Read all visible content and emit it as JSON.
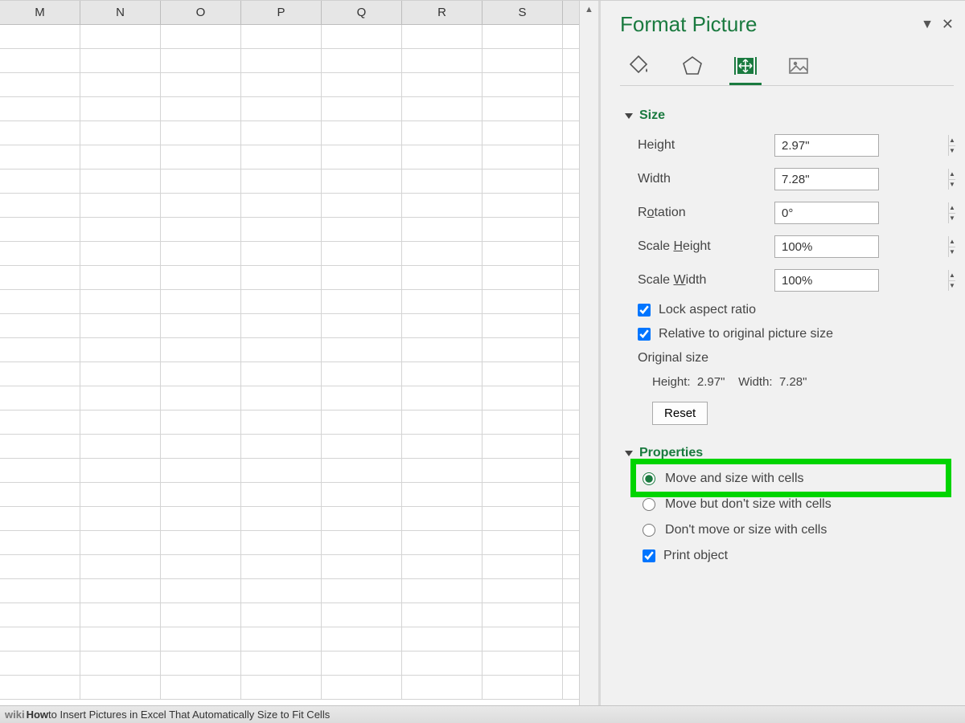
{
  "columns": [
    "M",
    "N",
    "O",
    "P",
    "Q",
    "R",
    "S"
  ],
  "rowCount": 28,
  "pane": {
    "title": "Format Picture",
    "menuGlyph": "▼",
    "closeGlyph": "✕",
    "tabs": {
      "fill": "fill-line-icon",
      "effects": "effects-icon",
      "size": "size-properties-icon",
      "picture": "picture-icon",
      "active": 2
    },
    "size": {
      "title": "Size",
      "height": {
        "label": "Height",
        "value": "2.97\""
      },
      "width": {
        "label": "Width",
        "value": "7.28\""
      },
      "rotation": {
        "label_pre": "R",
        "u": "o",
        "label_post": "tation",
        "value": "0°"
      },
      "scaleHeight": {
        "label_pre": "Scale ",
        "u": "H",
        "label_post": "eight",
        "value": "100%"
      },
      "scaleWidth": {
        "label_pre": "Scale ",
        "u": "W",
        "label_post": "idth",
        "value": "100%"
      },
      "lockAspect": {
        "label_pre": "Lock ",
        "u": "a",
        "label_post": "spect ratio",
        "checked": true
      },
      "relative": {
        "u": "R",
        "label_post": "elative to original picture size",
        "checked": true
      },
      "originalLabel": "Original size",
      "orig_h_label": "Height:",
      "orig_h": "2.97\"",
      "orig_w_label": "Width:",
      "orig_w": "7.28\"",
      "reset": {
        "pre": "Re",
        "u": "s",
        "post": "et"
      }
    },
    "properties": {
      "title": "Properties",
      "opt1": {
        "pre": "Move and ",
        "u": "s",
        "post": "ize with cells"
      },
      "opt2": {
        "u": "M",
        "post": "ove but don't size with cells"
      },
      "opt3": {
        "u": "D",
        "post": "on't move or size with cells"
      },
      "printObj": {
        "u": "P",
        "post": "rint object",
        "checked": true
      },
      "selected": 0
    }
  },
  "footer": {
    "brand": "wiki",
    "how": "How",
    "rest": " to Insert Pictures in Excel That Automatically Size to Fit Cells"
  }
}
